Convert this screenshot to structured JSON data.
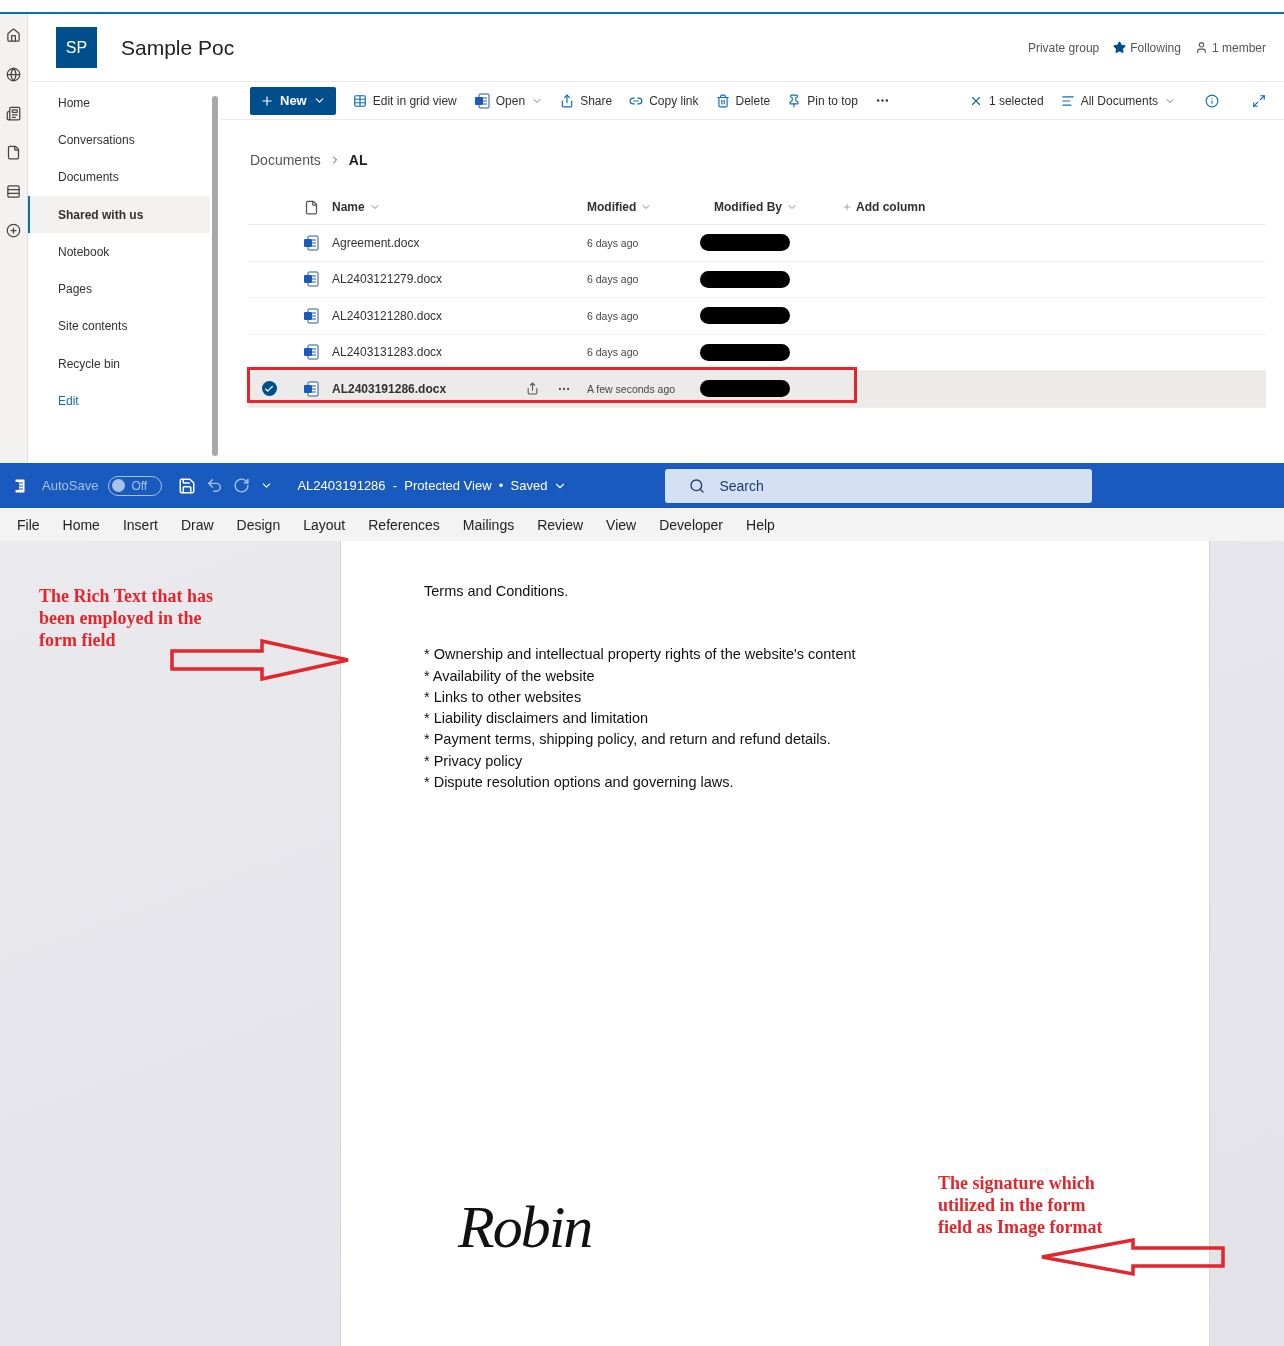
{
  "site": {
    "initials": "SP",
    "title": "Sample Poc",
    "meta": [
      {
        "kind": "text",
        "label": "Private group"
      },
      {
        "kind": "star",
        "label": "Following"
      },
      {
        "kind": "person",
        "label": "1 member"
      }
    ]
  },
  "nav": {
    "items": [
      {
        "label": "Home",
        "kind": "page",
        "selected": false
      },
      {
        "label": "Conversations",
        "kind": "page",
        "selected": false
      },
      {
        "label": "Documents",
        "kind": "page",
        "selected": false
      },
      {
        "label": "Shared with us",
        "kind": "page",
        "selected": true
      },
      {
        "label": "Notebook",
        "kind": "page",
        "selected": false
      },
      {
        "label": "Pages",
        "kind": "page",
        "selected": false
      },
      {
        "label": "Site contents",
        "kind": "page",
        "selected": false
      },
      {
        "label": "Recycle bin",
        "kind": "page",
        "selected": false
      },
      {
        "label": "Edit",
        "kind": "link",
        "selected": false
      }
    ]
  },
  "command_bar": {
    "new_label": "New",
    "commands": [
      {
        "kind": "grid",
        "label": "Edit in grid view",
        "dropdown": false
      },
      {
        "kind": "word",
        "label": "Open",
        "dropdown": true
      },
      {
        "kind": "share",
        "label": "Share",
        "dropdown": false
      },
      {
        "kind": "link",
        "label": "Copy link",
        "dropdown": false
      },
      {
        "kind": "delete",
        "label": "Delete",
        "dropdown": false
      },
      {
        "kind": "pin",
        "label": "Pin to top",
        "dropdown": false
      }
    ],
    "selection": "1 selected",
    "view": "All Documents"
  },
  "breadcrumb": [
    "Documents",
    "AL"
  ],
  "table": {
    "columns": [
      {
        "kind": "sort",
        "label": "Name"
      },
      {
        "kind": "sort",
        "label": "Modified"
      },
      {
        "kind": "sort",
        "label": "Modified By"
      },
      {
        "kind": "add",
        "label": "Add column"
      }
    ],
    "rows": [
      {
        "name": "Agreement.docx",
        "modified": "6 days ago",
        "redacted": true,
        "selected": false
      },
      {
        "name": "AL2403121279.docx",
        "modified": "6 days ago",
        "redacted": true,
        "selected": false
      },
      {
        "name": "AL2403121280.docx",
        "modified": "6 days ago",
        "redacted": true,
        "selected": false
      },
      {
        "name": "AL2403131283.docx",
        "modified": "6 days ago",
        "redacted": true,
        "selected": false
      },
      {
        "name": "AL2403191286.docx",
        "modified": "A few seconds ago",
        "redacted": true,
        "selected": true
      }
    ]
  },
  "word": {
    "autosave_label": "AutoSave",
    "autosave": {
      "on": false,
      "label": "Off"
    },
    "title": "AL2403191286  -  Protected View  •  Saved",
    "search_placeholder": "Search",
    "tabs": [
      "File",
      "Home",
      "Insert",
      "Draw",
      "Design",
      "Layout",
      "References",
      "Mailings",
      "Review",
      "View",
      "Developer",
      "Help"
    ]
  },
  "document": {
    "heading": "Terms and Conditions.",
    "bullets": [
      "* Ownership and intellectual property rights of the website's content",
      "* Availability of the website",
      "* Links to other websites",
      "* Liability disclaimers and limitation",
      "* Payment terms, shipping policy, and return and refund details.",
      "* Privacy policy",
      "* Dispute resolution options and governing laws."
    ],
    "signature": "Robin"
  },
  "annotations": {
    "rich_text_note": "The Rich Text that has been employed in the form field",
    "signature_note": "The signature which utilized in the form field as Image format"
  }
}
